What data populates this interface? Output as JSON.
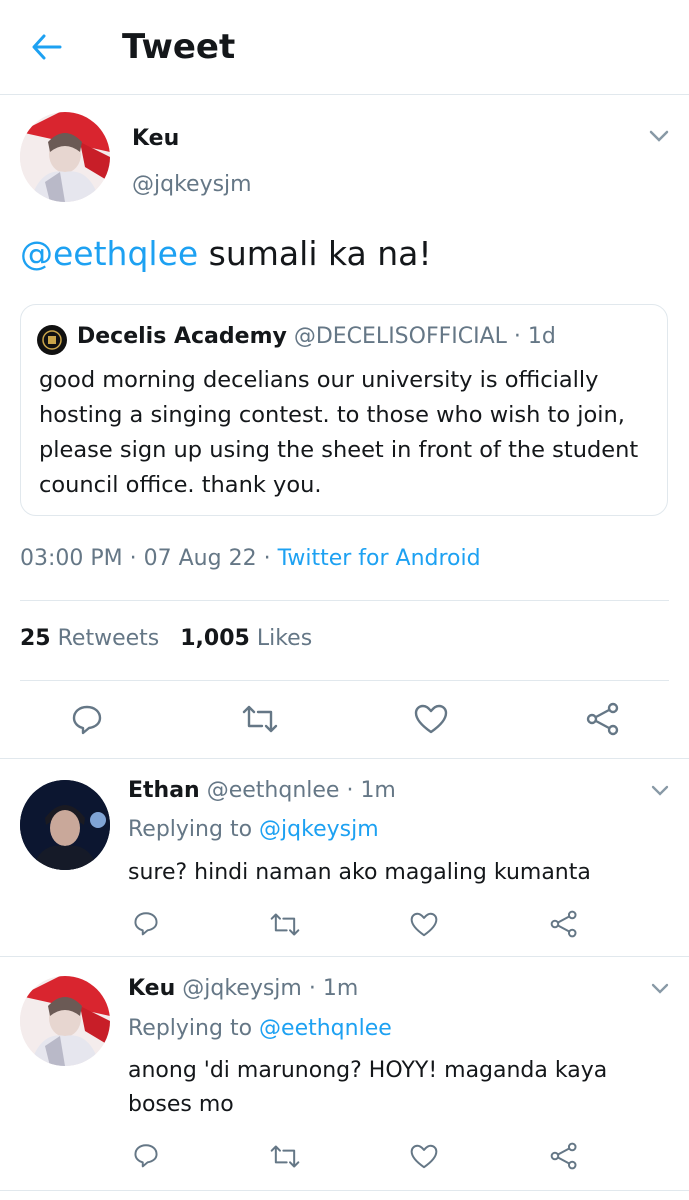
{
  "header": {
    "title": "Tweet",
    "back_icon": "arrow-left-icon"
  },
  "main_tweet": {
    "name": "Keu",
    "handle": "@jqkeysjm",
    "mention": "@eethqlee",
    "text": " sumali ka na!",
    "quoted": {
      "account_name": "Decelis Academy",
      "handle": "@DECELISOFFICIAL",
      "time": "· 1d",
      "text": "good morning decelians our university is officially hosting a singing contest. to those who wish to join, please sign up using the sheet in front of the student council office. thank you."
    },
    "meta": {
      "time": "03:00 PM",
      "date": "· 07 Aug 22 ·",
      "source": "Twitter for Android"
    },
    "stats": {
      "retweets_count": "25",
      "retweets_label": "Retweets",
      "likes_count": "1,005",
      "likes_label": "Likes"
    }
  },
  "replies": [
    {
      "name": "Ethan",
      "handle": "@eethqnlee",
      "time": "· 1m",
      "replying_label": "Replying to",
      "replying_to": "@jqkeysjm",
      "text": "sure? hindi naman ako magaling kumanta"
    },
    {
      "name": "Keu",
      "handle": "@jqkeysjm",
      "time": "· 1m",
      "replying_label": "Replying to",
      "replying_to": "@eethqnlee",
      "text": "anong 'di marunong? HOYY! maganda kaya boses mo"
    }
  ],
  "colors": {
    "accent": "#1da1f2",
    "secondary_text": "#657786",
    "divider": "#e1e8ed"
  }
}
